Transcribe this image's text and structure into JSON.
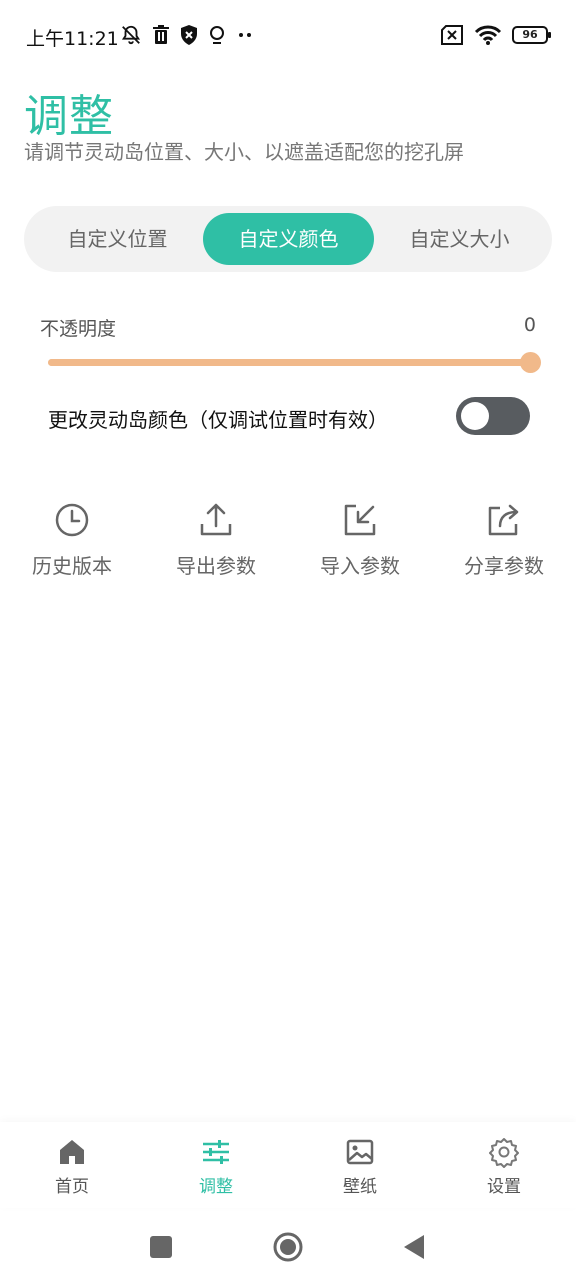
{
  "status_bar": {
    "time": "上午11:21",
    "left_icons": [
      "bell-off-icon",
      "trash-icon",
      "shield-icon",
      "bulb-icon",
      "more-dots-icon"
    ],
    "battery": "96"
  },
  "header": {
    "title": "调整",
    "subtitle": "请调节灵动岛位置、大小、以遮盖适配您的挖孔屏"
  },
  "tabs": [
    {
      "label": "自定义位置",
      "active": false
    },
    {
      "label": "自定义颜色",
      "active": true
    },
    {
      "label": "自定义大小",
      "active": false
    }
  ],
  "opacity": {
    "label": "不透明度",
    "value": "0",
    "slider_fraction": 1.0
  },
  "toggle": {
    "label": "更改灵动岛颜色（仅调试位置时有效）",
    "on": false
  },
  "actions": [
    {
      "label": "历史版本",
      "icon": "clock-icon"
    },
    {
      "label": "导出参数",
      "icon": "upload-icon"
    },
    {
      "label": "导入参数",
      "icon": "import-icon"
    },
    {
      "label": "分享参数",
      "icon": "share-icon"
    }
  ],
  "bottom_nav": [
    {
      "label": "首页",
      "icon": "home-icon",
      "active": false
    },
    {
      "label": "调整",
      "icon": "sliders-icon",
      "active": true
    },
    {
      "label": "壁纸",
      "icon": "image-icon",
      "active": false
    },
    {
      "label": "设置",
      "icon": "gear-icon",
      "active": false
    }
  ],
  "colors": {
    "accent": "#2fbfa5",
    "slider": "#f1b98a",
    "toggle_off": "#585c60"
  }
}
